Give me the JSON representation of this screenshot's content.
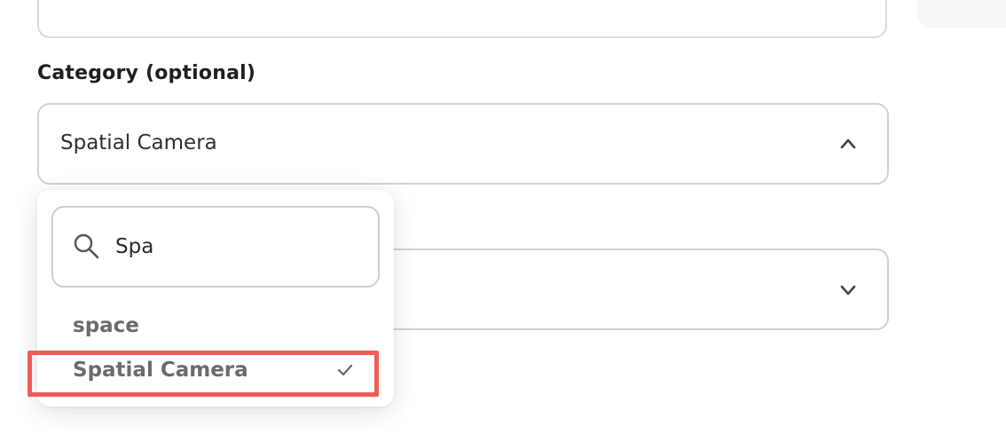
{
  "form": {
    "category_label": "Category (optional)",
    "category_value": "Spatial Camera"
  },
  "dropdown": {
    "search_value": "Spa",
    "options": [
      {
        "label": "space",
        "selected": false
      },
      {
        "label": "Spatial Camera",
        "selected": true
      }
    ]
  },
  "icons": {
    "search": "search-icon",
    "chevron_up": "chevron-up-icon",
    "chevron_down": "chevron-down-icon",
    "check": "check-icon"
  },
  "colors": {
    "highlight": "#f25a5a",
    "border": "#d2d2d2",
    "option_text": "#6b6b6b"
  }
}
